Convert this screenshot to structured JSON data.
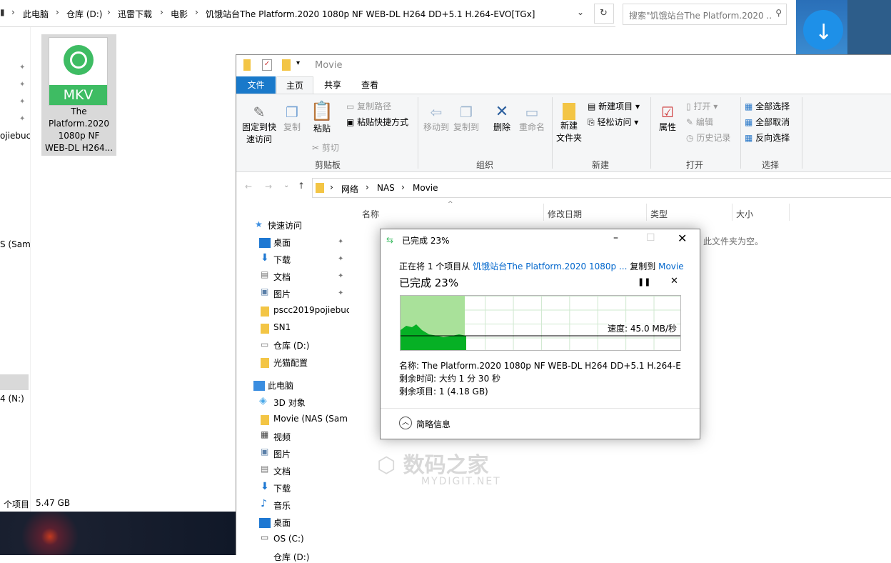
{
  "bg_window": {
    "breadcrumb": [
      "此电脑",
      "仓库 (D:)",
      "迅雷下载",
      "电影",
      "饥饿站台The Platform.2020 1080p NF WEB-DL H264 DD+5.1 H.264-EVO[TGx]"
    ],
    "search_placeholder": "搜索\"饥饿站台The Platform.2020 ...",
    "file": {
      "badge": "MKV",
      "name_lines": [
        "The",
        "Platform.2020",
        "1080p NF",
        "WEB-DL H264..."
      ]
    },
    "left_partial": [
      "ojiebuc",
      "S (Sam",
      "4 (N:)"
    ],
    "status": {
      "items": "个项目",
      "size": "5.47 GB"
    }
  },
  "explorer": {
    "title": "Movie",
    "tabs": {
      "file": "文件",
      "home": "主页",
      "share": "共享",
      "view": "查看"
    },
    "ribbon": {
      "pin": [
        "固定到快",
        "速访问"
      ],
      "copy": "复制",
      "paste": "粘贴",
      "copy_path": "复制路径",
      "paste_shortcut": "粘贴快捷方式",
      "cut": "剪切",
      "clipboard": "剪贴板",
      "move_to": "移动到",
      "copy_to": "复制到",
      "delete": "删除",
      "rename": "重命名",
      "organize": "组织",
      "new_folder": [
        "新建",
        "文件夹"
      ],
      "new_item": "新建项目",
      "easy_access": "轻松访问",
      "new_group": "新建",
      "properties": "属性",
      "open": "打开",
      "edit": "编辑",
      "history": "历史记录",
      "open_group": "打开",
      "select_all": "全部选择",
      "select_none": "全部取消",
      "invert": "反向选择",
      "select_group": "选择"
    },
    "address": [
      "网络",
      "NAS",
      "Movie"
    ],
    "columns": {
      "name": "名称",
      "modified": "修改日期",
      "type": "类型",
      "size": "大小"
    },
    "empty": "此文件夹为空。",
    "nav": {
      "quick_access": "快速访问",
      "items": [
        "桌面",
        "下载",
        "文档",
        "图片",
        "pscc2019pojiebuc",
        "SN1",
        "仓库 (D:)",
        "光猫配置"
      ],
      "this_pc": "此电脑",
      "pc_items": [
        "3D 对象",
        "Movie (NAS (Sam",
        "视频",
        "图片",
        "文档",
        "下载",
        "音乐",
        "桌面",
        "OS (C:)",
        "仓库 (D:)"
      ]
    }
  },
  "dialog": {
    "title": "已完成 23%",
    "line1_prefix": "正在将 1 个项目从",
    "source": "饥饿站台The Platform.2020 1080p ...",
    "copy_to": "复制到",
    "dest": "Movie",
    "progress_label": "已完成 23%",
    "progress_percent": 23,
    "speed": "速度: 45.0 MB/秒",
    "name": "名称: The Platform.2020 1080p NF WEB-DL H264 DD+5.1 H.264-E...",
    "remaining_time": "剩余时间: 大约 1 分 30 秒",
    "remaining_items": "剩余项目: 1 (4.18 GB)",
    "details": "简略信息"
  },
  "watermark": {
    "cn": "数码之家",
    "en": "MYDIGIT.NET"
  }
}
